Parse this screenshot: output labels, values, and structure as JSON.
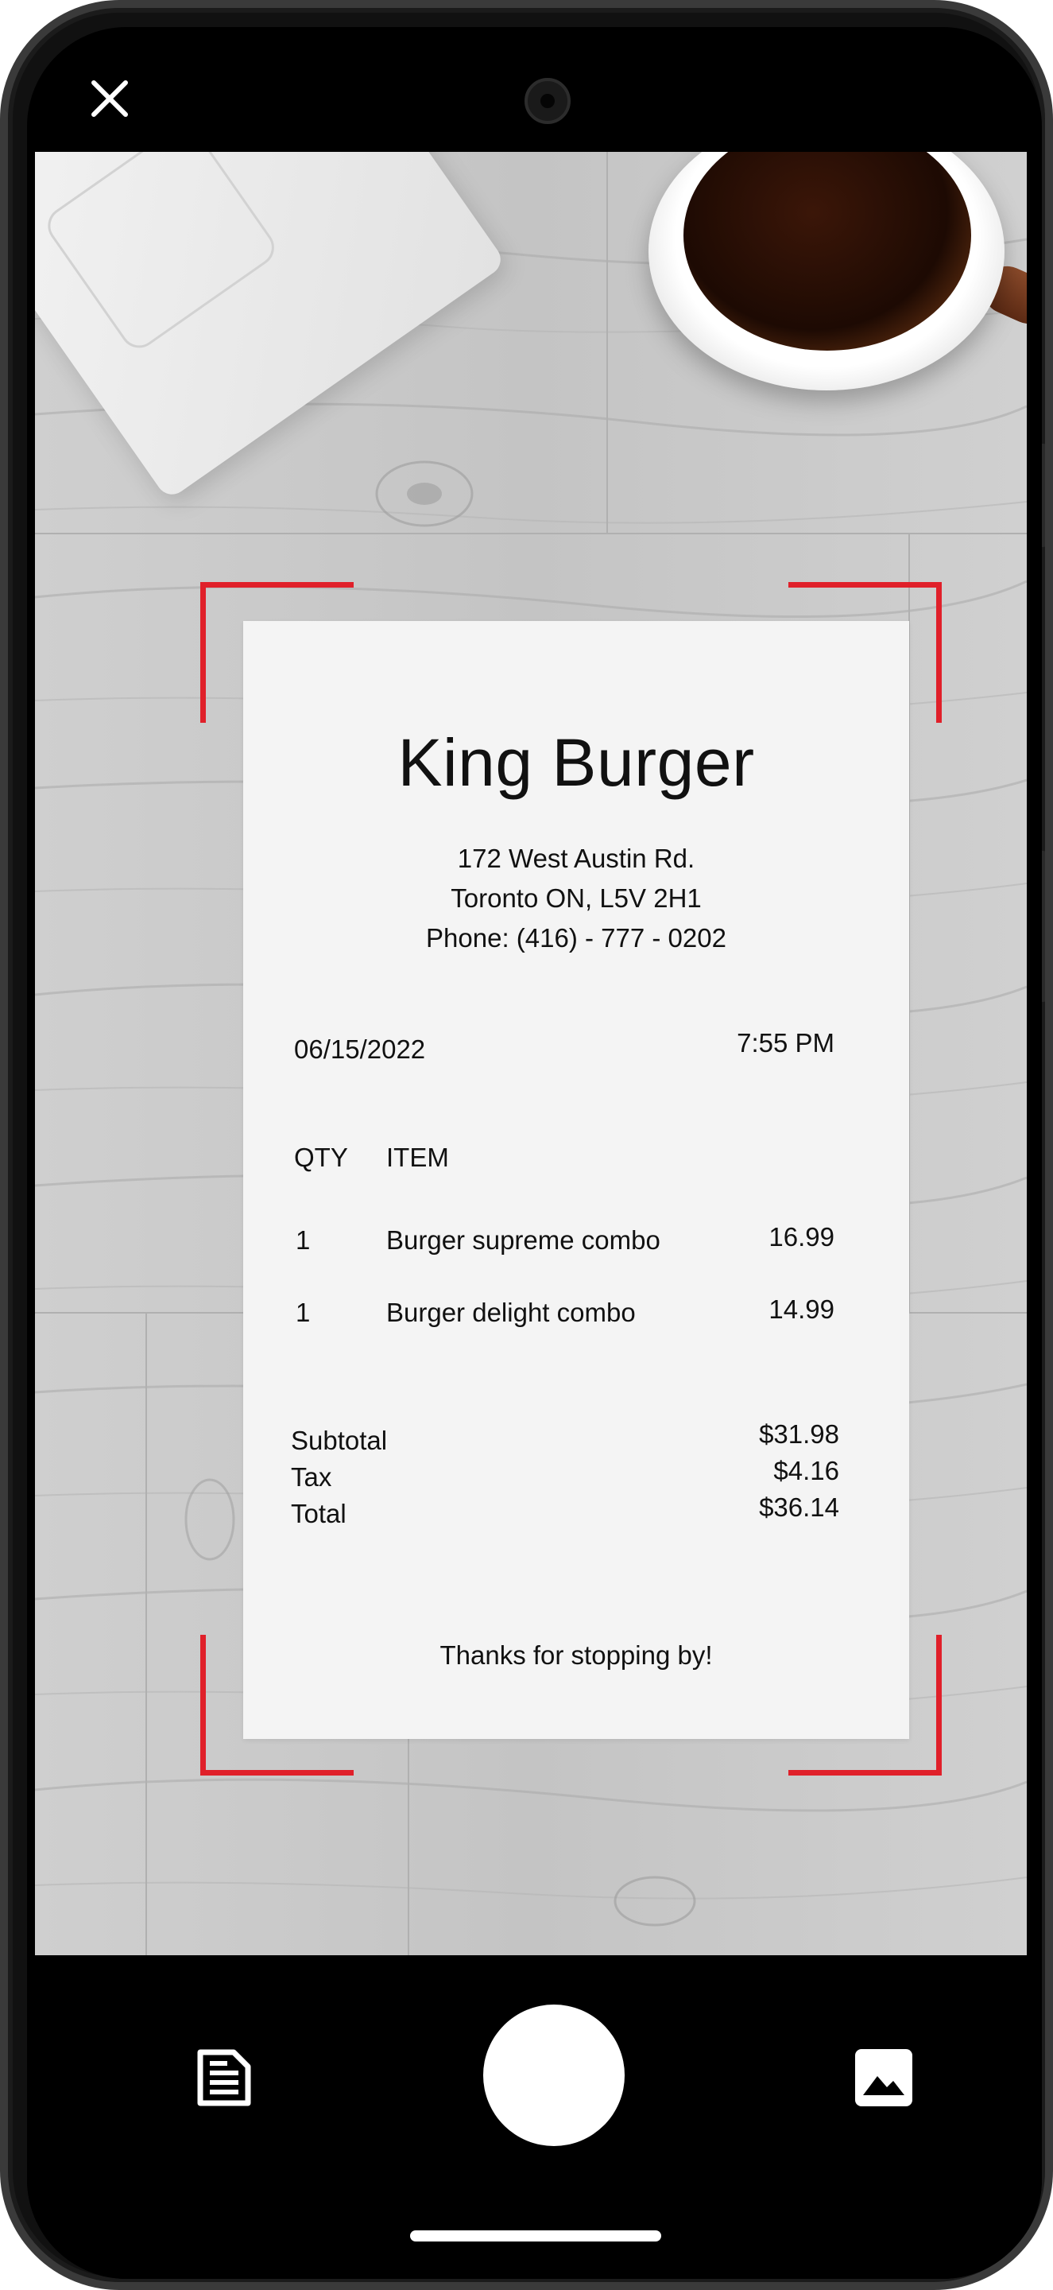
{
  "receipt": {
    "store_name": "King Burger",
    "address_line1": "172 West Austin Rd.",
    "address_line2": "Toronto ON, L5V 2H1",
    "phone": "Phone: (416) - 777 - 0202",
    "date": "06/15/2022",
    "time": "7:55 PM",
    "header_qty": "QTY",
    "header_item": "ITEM",
    "items": [
      {
        "qty": "1",
        "name": "Burger supreme combo",
        "price": "16.99"
      },
      {
        "qty": "1",
        "name": "Burger delight combo",
        "price": "14.99"
      }
    ],
    "subtotal_label": "Subtotal",
    "subtotal_value": "$31.98",
    "tax_label": "Tax",
    "tax_value": "$4.16",
    "total_label": "Total",
    "total_value": "$36.14",
    "footer": "Thanks for stopping by!"
  },
  "icons": {
    "close": "close-icon",
    "document": "document-icon",
    "gallery": "image-gallery-icon",
    "shutter": "shutter-button"
  },
  "colors": {
    "frame_corner": "#e0202a",
    "receipt_paper": "#f4f4f4",
    "bars": "#000000"
  }
}
